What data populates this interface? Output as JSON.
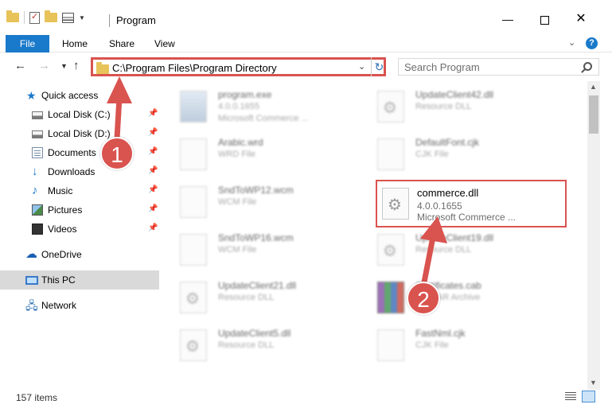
{
  "window": {
    "title": "Program",
    "minimize": "—",
    "close": "✕"
  },
  "ribbon": {
    "tabs": [
      "File",
      "Home",
      "Share",
      "View"
    ]
  },
  "address": {
    "path": "C:\\Program Files\\Program Directory"
  },
  "search": {
    "placeholder": "Search Program"
  },
  "sidebar": {
    "items": [
      {
        "label": "Quick access",
        "icon": "star-icon",
        "pinned": false
      },
      {
        "label": "Local Disk (C:)",
        "icon": "disk-icon",
        "pinned": true
      },
      {
        "label": "Local Disk (D:)",
        "icon": "disk-icon",
        "pinned": true
      },
      {
        "label": "Documents",
        "icon": "documents-icon",
        "pinned": true
      },
      {
        "label": "Downloads",
        "icon": "downloads-icon",
        "pinned": true
      },
      {
        "label": "Music",
        "icon": "music-icon",
        "pinned": true
      },
      {
        "label": "Pictures",
        "icon": "pictures-icon",
        "pinned": true
      },
      {
        "label": "Videos",
        "icon": "videos-icon",
        "pinned": true
      },
      {
        "label": "OneDrive",
        "icon": "onedrive-icon",
        "pinned": false
      },
      {
        "label": "This PC",
        "icon": "this-pc-icon",
        "pinned": false,
        "selected": true
      },
      {
        "label": "Network",
        "icon": "network-icon",
        "pinned": false
      }
    ]
  },
  "files": [
    {
      "name": "program.exe",
      "line2": "4.0.0.1655",
      "line3": "Microsoft Commerce ...",
      "type": "exe"
    },
    {
      "name": "UpdateClient42.dll",
      "line2": "Resource DLL",
      "line3": "",
      "type": "dll"
    },
    {
      "name": "Arabic.wrd",
      "line2": "WRD File",
      "line3": "",
      "type": "file"
    },
    {
      "name": "DefaultFont.cjk",
      "line2": "CJK File",
      "line3": "",
      "type": "file"
    },
    {
      "name": "SndToWP12.wcm",
      "line2": "WCM File",
      "line3": "",
      "type": "file"
    },
    {
      "name": "commerce.dll",
      "line2": "4.0.0.1655",
      "line3": "Microsoft Commerce ...",
      "type": "dll",
      "highlighted": true
    },
    {
      "name": "SndToWP16.wcm",
      "line2": "WCM File",
      "line3": "",
      "type": "file"
    },
    {
      "name": "UpdateClient19.dll",
      "line2": "Resource DLL",
      "line3": "",
      "type": "dll"
    },
    {
      "name": "UpdateClient21.dll",
      "line2": "Resource DLL",
      "line3": "",
      "type": "dll"
    },
    {
      "name": "Certificates.cab",
      "line2": "WinRAR Archive",
      "line3": "",
      "type": "cab"
    },
    {
      "name": "UpdateClient5.dll",
      "line2": "Resource DLL",
      "line3": "",
      "type": "dll"
    },
    {
      "name": "FastNml.cjk",
      "line2": "CJK File",
      "line3": "",
      "type": "file"
    }
  ],
  "status": {
    "item_count": "157 items"
  },
  "annotations": {
    "step1": "1",
    "step2": "2",
    "color": "#d9534f"
  }
}
